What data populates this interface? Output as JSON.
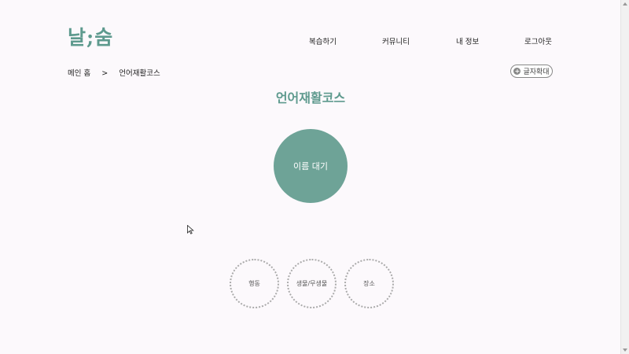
{
  "header": {
    "logo": "날;숨",
    "nav": [
      "복습하기",
      "커뮤니티",
      "내 정보",
      "로그아웃"
    ]
  },
  "breadcrumb": {
    "home": "메인 홈",
    "separator": ">",
    "current": "언어재활코스"
  },
  "zoom_button": {
    "label": "글자확대",
    "icon": "plus-icon"
  },
  "page_title": "언어재활코스",
  "main_option": {
    "label": "이름 대기"
  },
  "categories": [
    "행동",
    "생물/무생물",
    "장소"
  ],
  "colors": {
    "accent": "#6ea397",
    "title": "#5e9a8e",
    "background": "#fcf9fc"
  }
}
